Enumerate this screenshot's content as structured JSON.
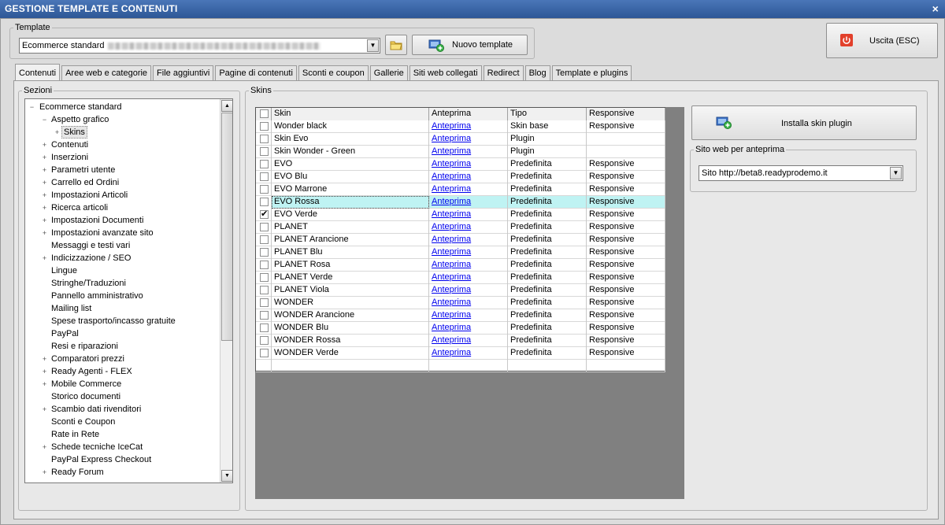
{
  "window": {
    "title": "GESTIONE TEMPLATE E CONTENUTI",
    "close_glyph": "×"
  },
  "template": {
    "legend": "Template",
    "selected": "Ecommerce standard",
    "new_button": "Nuovo template",
    "exit_button": "Uscita (ESC)"
  },
  "tabs": [
    "Contenuti",
    "Aree web e categorie",
    "File aggiuntivi",
    "Pagine di contenuti",
    "Sconti e coupon",
    "Gallerie",
    "Siti web collegati",
    "Redirect",
    "Blog",
    "Template e plugins"
  ],
  "sections": {
    "legend": "Sezioni",
    "tree": [
      {
        "label": "Ecommerce standard",
        "level": 0,
        "exp": "−"
      },
      {
        "label": "Aspetto grafico",
        "level": 1,
        "exp": "−"
      },
      {
        "label": "Skins",
        "level": 2,
        "exp": "+",
        "selected": true
      },
      {
        "label": "Contenuti",
        "level": 1,
        "exp": "+"
      },
      {
        "label": "Inserzioni",
        "level": 1,
        "exp": "+"
      },
      {
        "label": "Parametri utente",
        "level": 1,
        "exp": "+"
      },
      {
        "label": "Carrello ed Ordini",
        "level": 1,
        "exp": "+"
      },
      {
        "label": "Impostazioni Articoli",
        "level": 1,
        "exp": "+"
      },
      {
        "label": "Ricerca articoli",
        "level": 1,
        "exp": "+"
      },
      {
        "label": "Impostazioni Documenti",
        "level": 1,
        "exp": "+"
      },
      {
        "label": "Impostazioni avanzate sito",
        "level": 1,
        "exp": "+"
      },
      {
        "label": "Messaggi e testi vari",
        "level": 1,
        "exp": ""
      },
      {
        "label": "Indicizzazione / SEO",
        "level": 1,
        "exp": "+"
      },
      {
        "label": "Lingue",
        "level": 1,
        "exp": ""
      },
      {
        "label": "Stringhe/Traduzioni",
        "level": 1,
        "exp": ""
      },
      {
        "label": "Pannello amministrativo",
        "level": 1,
        "exp": ""
      },
      {
        "label": "Mailing list",
        "level": 1,
        "exp": ""
      },
      {
        "label": "Spese trasporto/incasso gratuite",
        "level": 1,
        "exp": ""
      },
      {
        "label": "PayPal",
        "level": 1,
        "exp": ""
      },
      {
        "label": "Resi e riparazioni",
        "level": 1,
        "exp": ""
      },
      {
        "label": "Comparatori prezzi",
        "level": 1,
        "exp": "+"
      },
      {
        "label": "Ready Agenti - FLEX",
        "level": 1,
        "exp": "+"
      },
      {
        "label": "Mobile Commerce",
        "level": 1,
        "exp": "+"
      },
      {
        "label": "Storico documenti",
        "level": 1,
        "exp": ""
      },
      {
        "label": "Scambio dati rivenditori",
        "level": 1,
        "exp": "+"
      },
      {
        "label": "Sconti e Coupon",
        "level": 1,
        "exp": ""
      },
      {
        "label": "Rate in Rete",
        "level": 1,
        "exp": ""
      },
      {
        "label": "Schede tecniche IceCat",
        "level": 1,
        "exp": "+"
      },
      {
        "label": "PayPal Express Checkout",
        "level": 1,
        "exp": ""
      },
      {
        "label": "Ready Forum",
        "level": 1,
        "exp": "+"
      }
    ]
  },
  "skins": {
    "legend": "Skins",
    "columns": [
      "Skin",
      "Anteprima",
      "Tipo",
      "Responsive"
    ],
    "rows": [
      {
        "skin": "Wonder black",
        "preview": "Anteprima",
        "type": "Skin base",
        "responsive": "Responsive",
        "checked": false
      },
      {
        "skin": "Skin Evo",
        "preview": "Anteprima",
        "type": "Plugin",
        "responsive": "",
        "checked": false
      },
      {
        "skin": "Skin Wonder - Green",
        "preview": "Anteprima",
        "type": "Plugin",
        "responsive": "",
        "checked": false
      },
      {
        "skin": "EVO",
        "preview": "Anteprima",
        "type": "Predefinita",
        "responsive": "Responsive",
        "checked": false
      },
      {
        "skin": "EVO Blu",
        "preview": "Anteprima",
        "type": "Predefinita",
        "responsive": "Responsive",
        "checked": false
      },
      {
        "skin": "EVO Marrone",
        "preview": "Anteprima",
        "type": "Predefinita",
        "responsive": "Responsive",
        "checked": false
      },
      {
        "skin": "EVO Rossa",
        "preview": "Anteprima",
        "type": "Predefinita",
        "responsive": "Responsive",
        "checked": false,
        "selected": true
      },
      {
        "skin": "EVO Verde",
        "preview": "Anteprima",
        "type": "Predefinita",
        "responsive": "Responsive",
        "checked": true
      },
      {
        "skin": "PLANET",
        "preview": "Anteprima",
        "type": "Predefinita",
        "responsive": "Responsive",
        "checked": false
      },
      {
        "skin": "PLANET Arancione",
        "preview": "Anteprima",
        "type": "Predefinita",
        "responsive": "Responsive",
        "checked": false
      },
      {
        "skin": "PLANET Blu",
        "preview": "Anteprima",
        "type": "Predefinita",
        "responsive": "Responsive",
        "checked": false
      },
      {
        "skin": "PLANET Rosa",
        "preview": "Anteprima",
        "type": "Predefinita",
        "responsive": "Responsive",
        "checked": false
      },
      {
        "skin": "PLANET Verde",
        "preview": "Anteprima",
        "type": "Predefinita",
        "responsive": "Responsive",
        "checked": false
      },
      {
        "skin": "PLANET Viola",
        "preview": "Anteprima",
        "type": "Predefinita",
        "responsive": "Responsive",
        "checked": false
      },
      {
        "skin": "WONDER",
        "preview": "Anteprima",
        "type": "Predefinita",
        "responsive": "Responsive",
        "checked": false
      },
      {
        "skin": "WONDER Arancione",
        "preview": "Anteprima",
        "type": "Predefinita",
        "responsive": "Responsive",
        "checked": false
      },
      {
        "skin": "WONDER Blu",
        "preview": "Anteprima",
        "type": "Predefinita",
        "responsive": "Responsive",
        "checked": false
      },
      {
        "skin": "WONDER Rossa",
        "preview": "Anteprima",
        "type": "Predefinita",
        "responsive": "Responsive",
        "checked": false
      },
      {
        "skin": "WONDER Verde",
        "preview": "Anteprima",
        "type": "Predefinita",
        "responsive": "Responsive",
        "checked": false
      }
    ],
    "check_glyph": "✔"
  },
  "install_button": "Installa skin plugin",
  "preview_site": {
    "legend": "Sito web per anteprima",
    "selected": "Sito http://beta8.readyprodemo.it"
  },
  "colors": {
    "selected_row": "#bff3f3",
    "titlebar": "#3a66a8",
    "exit_icon": "#e2402b"
  }
}
